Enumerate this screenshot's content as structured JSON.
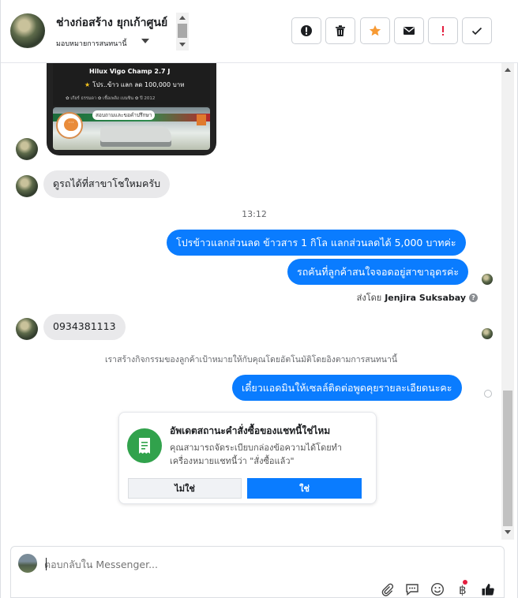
{
  "header": {
    "title": "ช่างก่อสร้าง ยุกเก้าศูนย์",
    "assign_label": "มอบหมายการสนทนานี้"
  },
  "toolbar": [
    {
      "name": "report-icon",
      "color": "#1c1e21"
    },
    {
      "name": "trash-icon",
      "color": "#1c1e21"
    },
    {
      "name": "star-icon",
      "color": "#f79a34"
    },
    {
      "name": "mail-icon",
      "color": "#1c1e21"
    },
    {
      "name": "exclaim-icon",
      "color": "#e41e3f"
    },
    {
      "name": "check-icon",
      "color": "#1c1e21"
    }
  ],
  "image_card": {
    "model": "Hilux Vigo Champ 2.7 J",
    "promo": "โปร..ข้าว แลก ลด 100,000 บาท",
    "meta": "✿ เกียร์ ธรรมดา   ✿ เชื้อเพลิง เบนซิน   ✿ ปี 2012",
    "overlay_pill": "สอบถามและขอคำปรึกษา"
  },
  "messages": {
    "incoming_1": "ดูรถได้ที่สาขาโชใหมครับ",
    "time": "13:12",
    "outgoing_1": "โปรข้าวแลกส่วนลด ข้าวสาร 1 กิโล แลกส่วนลดได้ 5,000 บาทค่ะ",
    "outgoing_2": "รถคันที่ลูกค้าสนใจจอดอยู่สาขาอุดรค่ะ",
    "sent_by_prefix": "ส่งโดย",
    "sent_by_name": "Jenjira Suksabay",
    "incoming_2": "0934381113",
    "notice": "เราสร้างกิจกรรมของลูกค้าเป้าหมายให้กับคุณโดยอัตโนมัติโดยอิงตามการสนทนานี้",
    "outgoing_3": "เดี๋ยวแอดมินให้เซลล์ติดต่อพูดคุยรายละเอียดนะคะ"
  },
  "order_card": {
    "title": "อัพเดตสถานะคำสั่งซื้อของแชทนี้ใช่ไหม",
    "description": "คุณสามารถจัดระเบียบกล่องข้อความได้โดยทำเครื่องหมายแชทนี้ว่า \"สั่งซื้อแล้ว\"",
    "no_label": "ไม่ใช่",
    "yes_label": "ใช่",
    "accent": "#31a24c"
  },
  "composer": {
    "placeholder": "ตอบกลับใน Messenger...",
    "icons": [
      "paperclip-icon",
      "chat-reply-icon",
      "smiley-icon",
      "baht-icon",
      "thumbs-up-icon"
    ]
  }
}
